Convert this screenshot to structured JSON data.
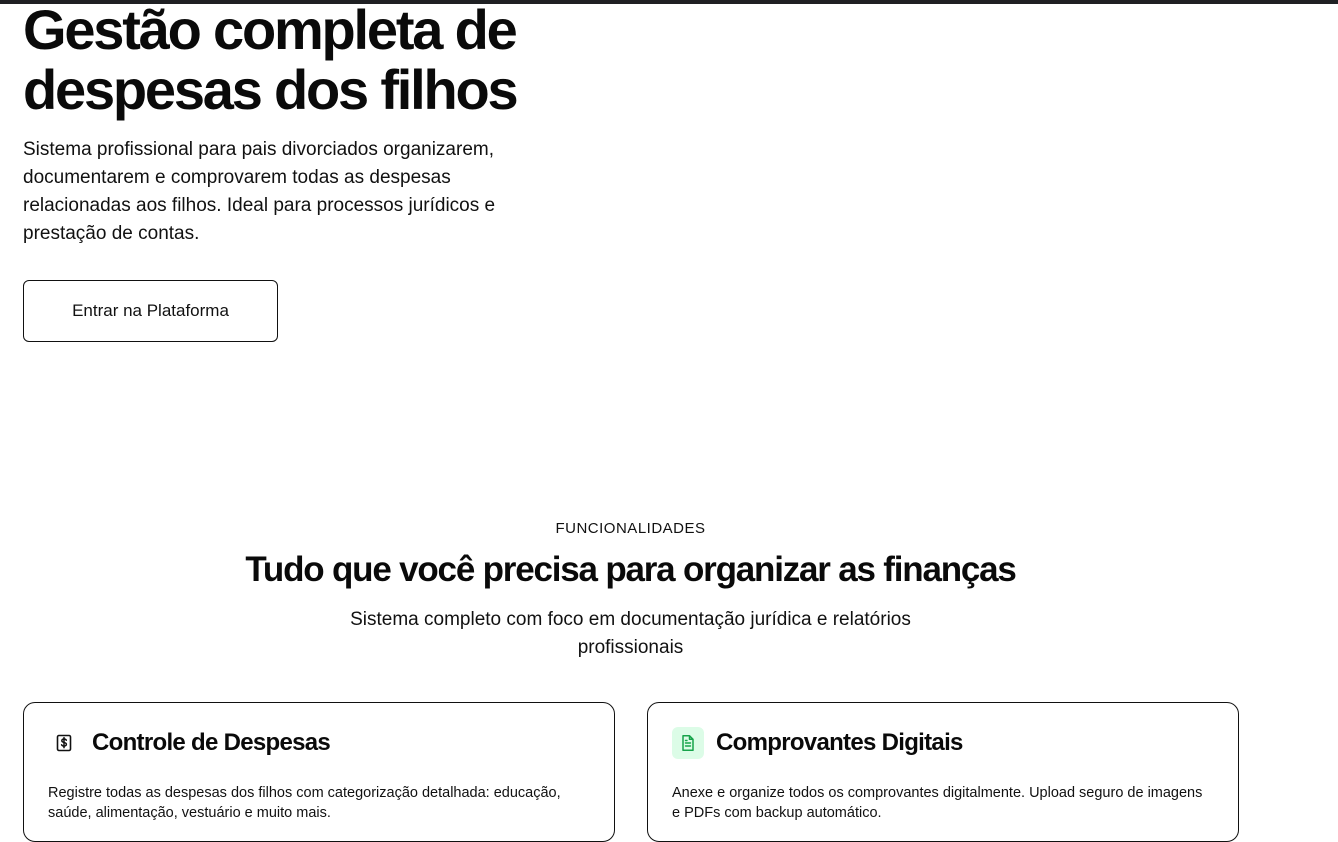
{
  "hero": {
    "title_line1": "Gestão completa de",
    "title_line2": "despesas dos filhos",
    "description": "Sistema profissional para pais divorciados organizarem, documentarem e comprovarem todas as despesas relacionadas aos filhos. Ideal para processos jurídicos e prestação de contas.",
    "cta_label": "Entrar na Plataforma"
  },
  "features": {
    "eyebrow": "FUNCIONALIDADES",
    "title": "Tudo que você precisa para organizar as finanças",
    "description": "Sistema completo com foco em documentação jurídica e relatórios profissionais",
    "cards": [
      {
        "icon": "dollar-receipt-icon",
        "title": "Controle de Despesas",
        "description": "Registre todas as despesas dos filhos com categorização detalhada: educação, saúde, alimentação, vestuário e muito mais."
      },
      {
        "icon": "document-icon",
        "icon_bg": "#dcfce7",
        "icon_color": "#16a34a",
        "title": "Comprovantes Digitais",
        "description": "Anexe e organize todos os comprovantes digitalmente. Upload seguro de imagens e PDFs com backup automático."
      }
    ]
  },
  "colors": {
    "topbar": "#1f2023",
    "text": "#0a0a0a",
    "border": "#111111"
  }
}
